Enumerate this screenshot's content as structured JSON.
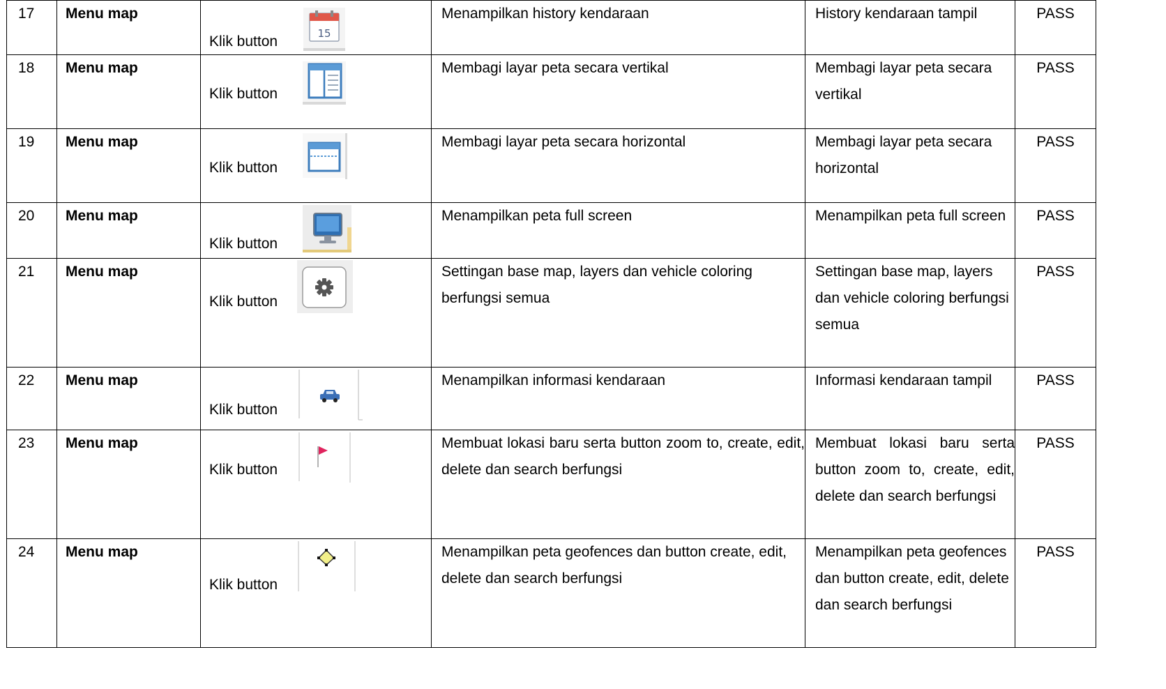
{
  "rows": [
    {
      "no": "17",
      "module": "Menu map",
      "action": "Klik button",
      "icon": "calendar-icon",
      "expected": "Menampilkan history kendaraan",
      "result": "History kendaraan tampil",
      "status": "PASS"
    },
    {
      "no": "18",
      "module": "Menu map",
      "action": "Klik button",
      "icon": "split-vertical-icon",
      "expected": "Membagi layar peta secara vertikal",
      "result": "Membagi layar peta secara vertikal",
      "status": "PASS"
    },
    {
      "no": "19",
      "module": "Menu map",
      "action": "Klik button",
      "icon": "split-horizontal-icon",
      "expected": "Membagi layar peta secara horizontal",
      "result": "Membagi layar peta secara horizontal",
      "status": "PASS"
    },
    {
      "no": "20",
      "module": "Menu map",
      "action": "Klik button",
      "icon": "monitor-icon",
      "expected": "Menampilkan peta full screen",
      "result": "Menampilkan peta full screen",
      "status": "PASS"
    },
    {
      "no": "21",
      "module": "Menu map",
      "action": "Klik button",
      "icon": "gear-icon",
      "expected": "Settingan base map, layers dan vehicle coloring berfungsi semua",
      "result": "Settingan base map, layers dan vehicle coloring berfungsi semua",
      "status": "PASS"
    },
    {
      "no": "22",
      "module": "Menu map",
      "action": "Klik button",
      "icon": "car-icon",
      "expected": "Menampilkan informasi kendaraan",
      "result": "Informasi kendaraan tampil",
      "status": "PASS"
    },
    {
      "no": "23",
      "module": "Menu map",
      "action": "Klik button",
      "icon": "flag-icon",
      "expected": "Membuat lokasi baru serta button zoom to, create, edit, delete dan search berfungsi",
      "result": "Membuat lokasi baru serta button zoom to, create, edit, delete dan search berfungsi",
      "status": "PASS"
    },
    {
      "no": "24",
      "module": "Menu map",
      "action": "Klik button",
      "icon": "geofence-icon",
      "expected": "Menampilkan peta geofences dan button create, edit, delete dan search berfungsi",
      "result": "Menampilkan peta geofences dan button create, edit, delete dan search berfungsi",
      "status": "PASS"
    }
  ]
}
